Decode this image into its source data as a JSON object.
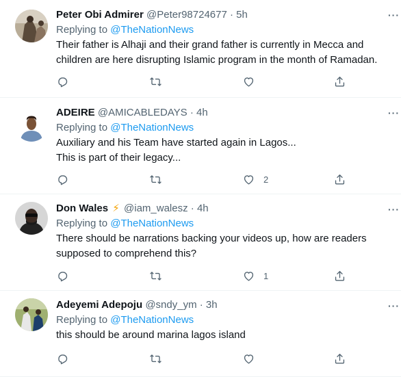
{
  "tweets": [
    {
      "name": "Peter Obi Admirer",
      "handle": "@Peter98724677",
      "dot": "·",
      "time": "5h",
      "replying_prefix": "Replying to",
      "replying_to": "@TheNationNews",
      "text": "Their father is Alhaji and their grand father is currently in Mecca and children are here disrupting Islamic program in the month of Ramadan.",
      "likes": "",
      "avatar": "profile-photo"
    },
    {
      "name": "ADEIRE",
      "handle": "@AMICABLEDAYS",
      "dot": "·",
      "time": "4h",
      "replying_prefix": "Replying to",
      "replying_to": "@TheNationNews",
      "text_line1": "Auxiliary and his Team have started again in Lagos...",
      "text_line2": "This is part of their legacy...",
      "likes": "2",
      "avatar": "profile-photo"
    },
    {
      "name": "Don Wales",
      "emoji": "⚡",
      "handle": "@iam_walesz",
      "dot": "·",
      "time": "4h",
      "replying_prefix": "Replying to",
      "replying_to": "@TheNationNews",
      "text": "There should be narrations backing your videos up, how are readers supposed to comprehend this?",
      "likes": "1",
      "avatar": "profile-photo"
    },
    {
      "name": "Adeyemi Adepoju",
      "handle": "@sndy_ym",
      "dot": "·",
      "time": "3h",
      "replying_prefix": "Replying to",
      "replying_to": "@TheNationNews",
      "text": "this should be around marina lagos island",
      "likes": "",
      "avatar": "profile-photo"
    }
  ],
  "icons": {
    "reply": "reply-icon",
    "retweet": "retweet-icon",
    "like": "heart-icon",
    "share": "share-icon",
    "more": "more-icon"
  },
  "more_glyph": "···",
  "colors": {
    "accent": "#1d9bf0",
    "secondary_text": "#536471",
    "primary_text": "#0f1419",
    "divider": "#eff3f4"
  }
}
